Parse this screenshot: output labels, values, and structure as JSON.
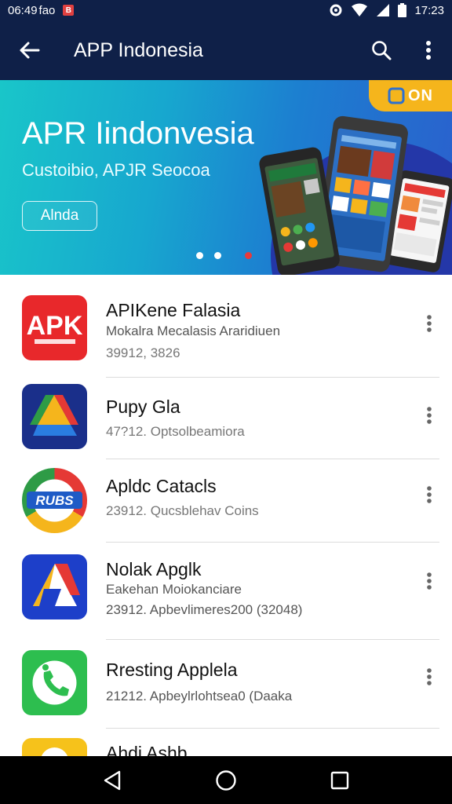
{
  "status_bar": {
    "time_left": "06:49",
    "carrier": "fao",
    "time_right": "17:23"
  },
  "app_bar": {
    "title": "APP Indonesia",
    "back_icon": "arrow-left-icon",
    "search_icon": "search-icon",
    "more_icon": "more-vert-icon"
  },
  "banner": {
    "title": "APR Iindonvesia",
    "subtitle": "Custoibio, APJR Seocoa",
    "button_label": "Alnda",
    "badge_text": "ON",
    "colors": {
      "gradient_start": "#19c6c9",
      "gradient_end": "#2b5fcd",
      "badge": "#f5b51c",
      "active_dot": "#e83a3a"
    },
    "pager": {
      "count": 3,
      "active_index": 2
    }
  },
  "apps": [
    {
      "name": "APIKene Falasia",
      "line1": "Mokalra Mecalasis Araridiuen",
      "line2": "39912, 3826",
      "icon": "apk-red-icon"
    },
    {
      "name": "Pupy Gla",
      "line1": "47?12. Optsolbeamiora",
      "line2": "",
      "icon": "drive-triangle-icon"
    },
    {
      "name": "Apldc Catacls",
      "line1": "23912. Qucsblehav Coins",
      "line2": "",
      "icon": "chrome-badge-icon"
    },
    {
      "name": "Nolak Apglk",
      "line1": "Eakehan Moiokanciare",
      "line2": "23912. Apbevlimeres200 (32048)",
      "icon": "triangle-app-icon"
    },
    {
      "name": "Rresting Applela",
      "line1": "21212. Apbeylrlohtsea0 (Daaka",
      "line2": "",
      "icon": "phone-green-icon"
    },
    {
      "name": "Ahdi Ashb",
      "line1": "",
      "line2": "",
      "icon": "yellow-app-icon"
    }
  ],
  "nav_bar": {
    "back_icon": "nav-back-icon",
    "home_icon": "nav-home-icon",
    "recents_icon": "nav-recents-icon"
  }
}
